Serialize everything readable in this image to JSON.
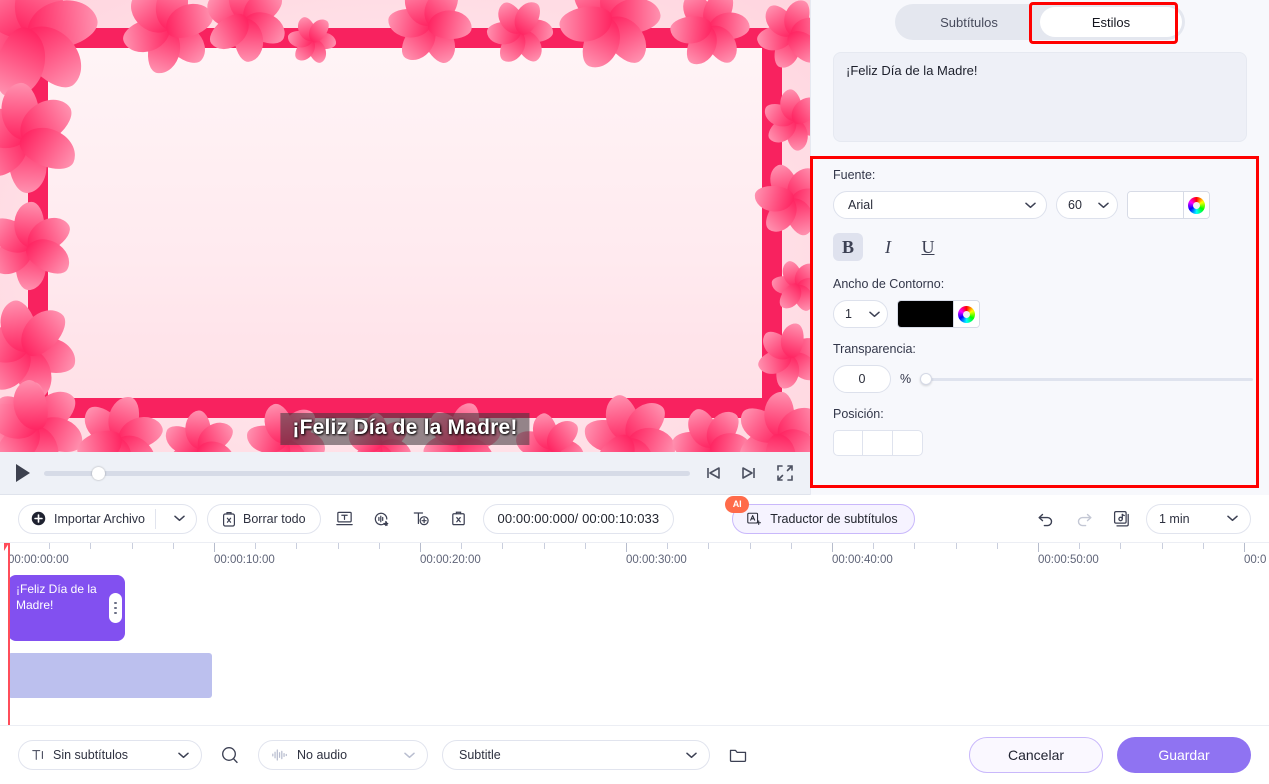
{
  "preview": {
    "subtitle_overlay": "¡Feliz Día de la Madre!"
  },
  "player": {
    "play_label": "play-button",
    "prev_frame": "prev-frame",
    "next_frame": "next-frame",
    "fullscreen": "fullscreen"
  },
  "toolbar": {
    "import_label": "Importar Archivo",
    "clear_all_label": "Borrar todo",
    "time_display": "00:00:00:000/ 00:00:10:033",
    "translator_label": "Traductor de subtítulos",
    "ai_badge": "AI",
    "duration_value": "1 min"
  },
  "timeline": {
    "labels": [
      "00:00:00:00",
      "00:00:10:00",
      "00:00:20:00",
      "00:00:30:00",
      "00:00:40:00",
      "00:00:50:00",
      "00:0"
    ],
    "clip_text": "¡Feliz Día de la Madre!"
  },
  "bottombar": {
    "subtitle_select": "Sin subtítulos",
    "audio_select": "No audio",
    "format_select": "Subtitle",
    "cancel_label": "Cancelar",
    "save_label": "Guardar"
  },
  "panel": {
    "tabs": [
      {
        "label": "Subtítulos",
        "active": false
      },
      {
        "label": "Estilos",
        "active": true
      }
    ],
    "subtitle_text": "¡Feliz Día de la Madre!",
    "font_label": "Fuente:",
    "font_family": "Arial",
    "font_size": "60",
    "font_color": "#ffffff",
    "bold": "B",
    "italic": "I",
    "underline": "U",
    "outline_label": "Ancho de Contorno:",
    "outline_width": "1",
    "outline_color": "#000000",
    "transparency_label": "Transparencia:",
    "transparency_value": "0",
    "transparency_unit": "%",
    "position_label": "Posición:"
  },
  "colors": {
    "accent": "#8f73f2",
    "highlight": "#ff0000",
    "clip": "#8250f0",
    "audio_clip": "#bcc0ee",
    "playhead": "#ff4d5a"
  }
}
